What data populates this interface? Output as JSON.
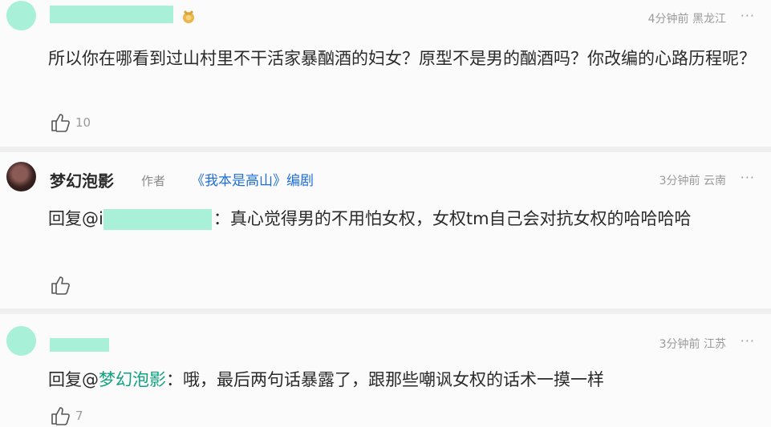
{
  "comments": [
    {
      "meta": {
        "time": "4分钟前",
        "location": "黑龙江"
      },
      "body": "所以你在哪看到过山村里不干活家暴酗酒的妇女？原型不是男的酗酒吗？你改编的心路历程呢？",
      "likes": "10",
      "more": "···"
    },
    {
      "author": "梦幻泡影",
      "author_tag": "作者",
      "drama_tag": "《我本是高山》编剧",
      "meta": {
        "time": "3分钟前",
        "location": "云南"
      },
      "reply_prefix": "回复@i",
      "reply_sep": "：",
      "body": "真心觉得男的不用怕女权，女权tm自己会对抗女权的哈哈哈哈",
      "likes": "",
      "more": "···"
    },
    {
      "meta": {
        "time": "3分钟前",
        "location": "江苏"
      },
      "reply_prefix": "回复@",
      "reply_name": "梦幻泡影",
      "reply_sep": "：",
      "body": "哦，最后两句话暴露了，跟那些嘲讽女权的话术一摸一样",
      "likes": "7",
      "more": "···"
    }
  ],
  "colors": {
    "mask": "#a8f0d8",
    "link": "#1f6fd6",
    "mention": "#12a27f",
    "muted": "#9a9a9a"
  },
  "icons": {
    "like": "thumbs-up-icon",
    "more": "more-dots-icon",
    "badge": "medal-badge-icon"
  }
}
